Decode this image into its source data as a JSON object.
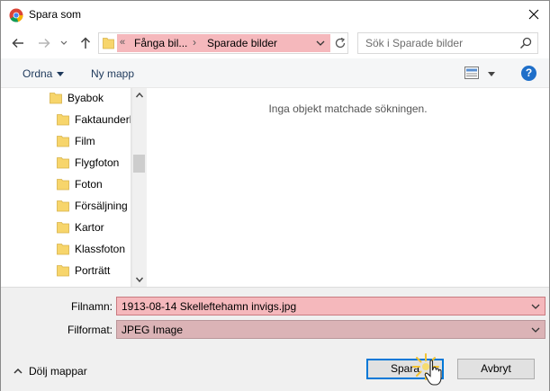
{
  "window": {
    "title": "Spara som"
  },
  "address": {
    "overflow": "«",
    "crumbs": [
      "Fånga bil...",
      "Sparade bilder"
    ],
    "separator": "›"
  },
  "search": {
    "placeholder": "Sök i Sparade bilder"
  },
  "toolbar": {
    "organize": "Ordna",
    "new_folder": "Ny mapp",
    "help": "?"
  },
  "tree": {
    "items": [
      {
        "label": "Byabok"
      },
      {
        "label": "Faktaunderl"
      },
      {
        "label": "Film"
      },
      {
        "label": "Flygfoton"
      },
      {
        "label": "Foton"
      },
      {
        "label": "Försäljning"
      },
      {
        "label": "Kartor"
      },
      {
        "label": "Klassfoton"
      },
      {
        "label": "Porträtt"
      }
    ]
  },
  "files": {
    "empty_message": "Inga objekt matchade sökningen."
  },
  "form": {
    "filename_label": "Filnamn:",
    "filename_value": "1913-08-14 Skelleftehamn invigs.jpg",
    "filetype_label": "Filformat:",
    "filetype_value": "JPEG Image"
  },
  "footer": {
    "hide_folders": "Dölj mappar",
    "save": "Spara",
    "cancel": "Avbryt"
  },
  "colors": {
    "highlight": "#f5b8bc",
    "accent": "#0078d7",
    "folder": "#f7d56b"
  }
}
